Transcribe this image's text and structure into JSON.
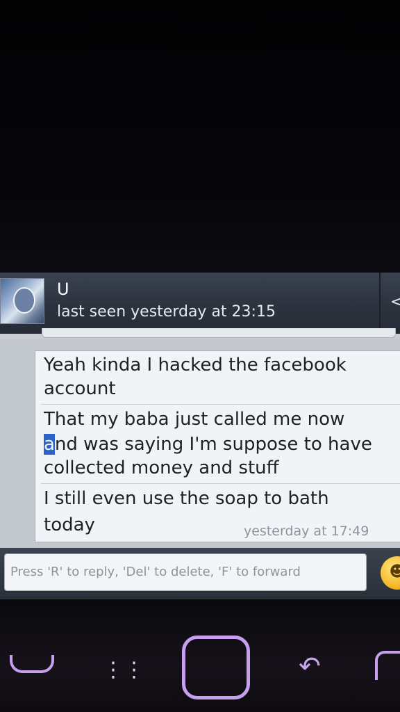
{
  "header": {
    "contact_name": "U",
    "last_seen": "last seen yesterday at 23:15"
  },
  "chat": {
    "messages": [
      {
        "lines": [
          "Yeah kinda I hacked the facebook",
          "account"
        ]
      },
      {
        "lines": [
          "That my baba just called me now",
          "and was saying I'm suppose to have",
          "collected money and stuff"
        ]
      },
      {
        "lines": [
          "I still even use the soap to bath",
          "today"
        ]
      }
    ],
    "timestamp": "yesterday at 17:49"
  },
  "compose": {
    "placeholder": "Press 'R' to reply, 'Del' to delete, 'F' to forward",
    "emoji_icon": "smiley-emoji-icon"
  },
  "hardware_keys": [
    "call-key-icon",
    "blackberry-menu-icon",
    "home-key-icon",
    "back-key-icon",
    "end-call-key-icon"
  ],
  "colors": {
    "header_bg": "#2c333f",
    "bubble_bg": "#f1f3f6",
    "cursor_highlight": "#2d62c9",
    "key_glow": "#c6a0ee"
  }
}
